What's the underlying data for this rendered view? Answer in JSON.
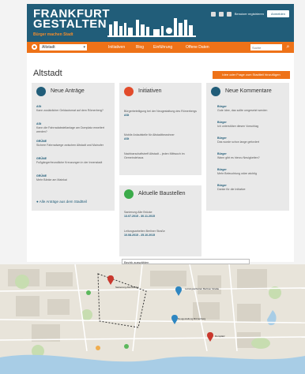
{
  "brand": {
    "title_line1": "FRANKFURT",
    "title_line2": "GESTALTEN",
    "subtitle": "Bürger machen Stadt"
  },
  "top_links": {
    "link1": "Benutzer registrieren",
    "login": "Anmelden"
  },
  "nav": {
    "city": "Altstadt",
    "items": [
      "Initiativen",
      "Blog",
      "Einführung",
      "Offene Daten"
    ],
    "search_placeholder": "Suche"
  },
  "page": {
    "title": "Altstadt",
    "new_idea_button": "Idee oder Frage zum Stadtteil hinzufügen"
  },
  "columns": {
    "antraege": {
      "title": "Neue Anträge",
      "items": [
        {
          "meta": "ASt",
          "text": "Kann zusätzlicher Geldautomat auf dem Römerberg?"
        },
        {
          "meta": "ASt",
          "text": "Kann die Fahrradabstellanlage am Domplatz erweitert werden?"
        },
        {
          "meta": "GRÜNE",
          "text": "Sichere Fahrradwege zwischen Altstadt und Mainufer"
        },
        {
          "meta": "GRÜNE",
          "text": "Fußgängerfreundliche Kreuzungen in der Innenstadt"
        },
        {
          "meta": "GRÜNE",
          "text": "Mehr Bänke am Mainkai"
        }
      ],
      "more": "Alle Anträge aus dem Stadtteil"
    },
    "initiativen": {
      "title": "Initiativen",
      "items": [
        {
          "text": "Bürgerbeteiligung bei der Neugestaltung des Römerbergs",
          "meta": "ASt"
        },
        {
          "text": "Mobile Anlaufstelle für Altstadtbewohner",
          "meta": "ASt"
        },
        {
          "text": "Nachbarschaftstreff Altstadt – jeden Mittwoch im Gemeindehaus",
          "meta": ""
        }
      ]
    },
    "baustellen": {
      "title": "Aktuelle Baustellen",
      "items": [
        {
          "text": "Sanierung Alte Brücke",
          "meta": "13.07.2015 - 30.11.2015"
        },
        {
          "text": "Leitungsarbeiten Berliner Straße",
          "meta": "10.08.2015 - 25.10.2015"
        }
      ]
    },
    "kommentare": {
      "title": "Neue Kommentare",
      "items": [
        {
          "meta": "Bürger",
          "text": "Gute Idee, das sollte umgesetzt werden"
        },
        {
          "meta": "Bürger",
          "text": "Ich unterstütze diesen Vorschlag"
        },
        {
          "meta": "Bürger",
          "text": "Das wurde schon lange gefordert"
        },
        {
          "meta": "Bürger",
          "text": "Wann gibt es hierzu Neuigkeiten?"
        },
        {
          "meta": "Bürger",
          "text": "Mehr Beleuchtung wäre wichtig"
        },
        {
          "meta": "Bürger",
          "text": "Danke für die Initiative"
        }
      ]
    }
  },
  "filter": {
    "label": "Bezirk auswählen"
  },
  "colors": {
    "primary": "#215d79",
    "accent": "#ee7218"
  }
}
